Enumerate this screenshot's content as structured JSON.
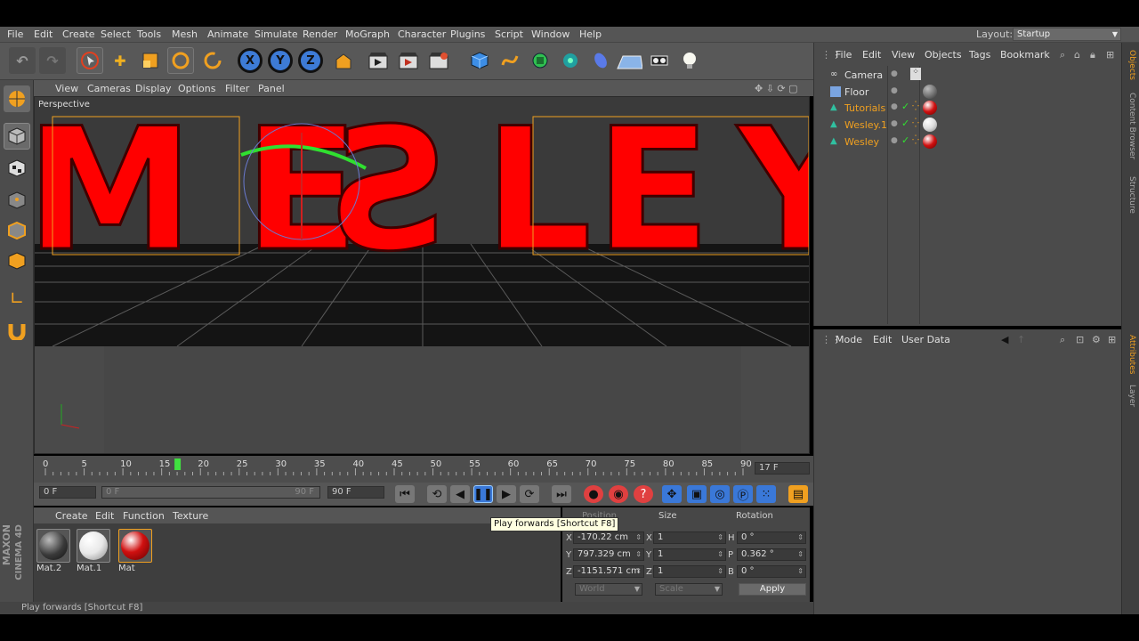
{
  "menu": [
    "File",
    "Edit",
    "Create",
    "Select",
    "Tools",
    "Mesh",
    "Animate",
    "Simulate",
    "Render",
    "MoGraph",
    "Character",
    "Plugins",
    "Script",
    "Window",
    "Help"
  ],
  "layout": {
    "label": "Layout:",
    "value": "Startup"
  },
  "toolbar": {
    "icons": [
      "undo-icon",
      "redo-icon",
      "live-selection-icon",
      "move-icon",
      "scale-icon",
      "rotate-icon",
      "recent-tool-icon",
      "x-axis-icon",
      "y-axis-icon",
      "z-axis-icon",
      "coordinate-system-icon",
      "render-view-icon",
      "render-picture-viewer-icon",
      "render-settings-icon",
      "cube-icon",
      "spline-icon",
      "nurbs-icon",
      "array-icon",
      "deformer-icon",
      "floor-icon",
      "camera-icon",
      "light-icon"
    ],
    "x_label": "X",
    "y_label": "Y",
    "z_label": "Z"
  },
  "viewport": {
    "menu": [
      "View",
      "Cameras",
      "Display",
      "Options",
      "Filter",
      "Panel"
    ],
    "label": "Perspective",
    "text3d": "WESLEY"
  },
  "timeline": {
    "ticks": [
      "0",
      "5",
      "10",
      "15",
      "20",
      "25",
      "30",
      "35",
      "40",
      "45",
      "50",
      "55",
      "60",
      "65",
      "70",
      "75",
      "80",
      "85",
      "90"
    ],
    "current_frame_marker": 17,
    "current_frame_display": "17 F",
    "start_field": "0 F",
    "range_start": "0 F",
    "range_end": "90 F",
    "end_field": "90 F"
  },
  "materials": {
    "menu": [
      "Create",
      "Edit",
      "Function",
      "Texture"
    ],
    "items": [
      {
        "name": "Mat.2",
        "color": "#3a3a3a"
      },
      {
        "name": "Mat.1",
        "color": "#e8e8e8"
      },
      {
        "name": "Mat",
        "color": "#d01010"
      }
    ]
  },
  "coords": {
    "headers": {
      "position": "Position",
      "size": "Size",
      "rotation": "Rotation"
    },
    "rows": [
      {
        "axis": "X",
        "pos": "-170.22 cm",
        "saxis": "X",
        "size": "1",
        "raxis": "H",
        "rot": "0 °"
      },
      {
        "axis": "Y",
        "pos": "797.329 cm",
        "saxis": "Y",
        "size": "1",
        "raxis": "P",
        "rot": "0.362 °"
      },
      {
        "axis": "Z",
        "pos": "-1151.571 cm",
        "saxis": "Z",
        "size": "1",
        "raxis": "B",
        "rot": "0 °"
      }
    ],
    "world": "World",
    "scale": "Scale",
    "apply": "Apply"
  },
  "tooltip": "Play forwards [Shortcut F8]",
  "status": "Play forwards [Shortcut F8]",
  "brand": {
    "line1": "MAXON",
    "line2": "CINEMA 4D"
  },
  "objects": {
    "menu": [
      "File",
      "Edit",
      "View",
      "Objects",
      "Tags",
      "Bookmark"
    ],
    "items": [
      {
        "name": "Camera",
        "color": "#e0e0e0"
      },
      {
        "name": "Floor",
        "color": "#e0e0e0"
      },
      {
        "name": "Tutorials",
        "color": "#f0a020"
      },
      {
        "name": "Wesley.1",
        "color": "#f0a020"
      },
      {
        "name": "Wesley",
        "color": "#f0a020"
      }
    ]
  },
  "attributes": {
    "menu": [
      "Mode",
      "Edit",
      "User Data"
    ]
  },
  "side_tabs": {
    "top": [
      "Objects",
      "Content Browser",
      "Structure"
    ],
    "bottom": [
      "Attributes",
      "Layer"
    ]
  },
  "colors": {
    "accent": "#f0a020",
    "red": "#ff0000",
    "bg": "#4b4b4b"
  }
}
